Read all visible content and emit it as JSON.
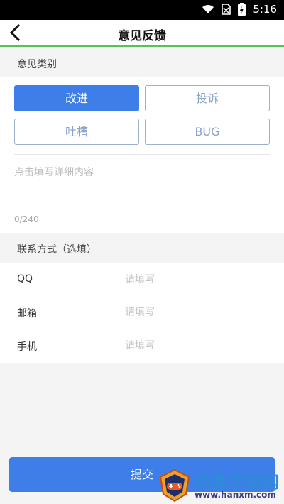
{
  "status_bar": {
    "time": "5:16",
    "icons": [
      "wifi-icon",
      "no-sim-icon",
      "battery-charging-icon"
    ]
  },
  "header": {
    "title": "意见反馈",
    "back_icon": "chevron-left-icon"
  },
  "feedback_type": {
    "label": "意见类别",
    "options": [
      {
        "label": "改进",
        "selected": true
      },
      {
        "label": "投诉",
        "selected": false
      },
      {
        "label": "吐槽",
        "selected": false
      },
      {
        "label": "BUG",
        "selected": false
      }
    ]
  },
  "detail": {
    "placeholder": "点击填写详细内容",
    "counter": "0/240"
  },
  "contact": {
    "label": "联系方式（选填）",
    "fields": [
      {
        "label": "QQ",
        "placeholder": "请填写"
      },
      {
        "label": "邮箱",
        "placeholder": "请填写"
      },
      {
        "label": "手机",
        "placeholder": "请填写"
      }
    ]
  },
  "submit_label": "提交",
  "watermark": {
    "brand": "西美手游网",
    "site": "www.hanxm.com"
  },
  "colors": {
    "accent": "#3d7ee8",
    "header_underline": "#5ac05a",
    "background": "#f4f4f4"
  }
}
